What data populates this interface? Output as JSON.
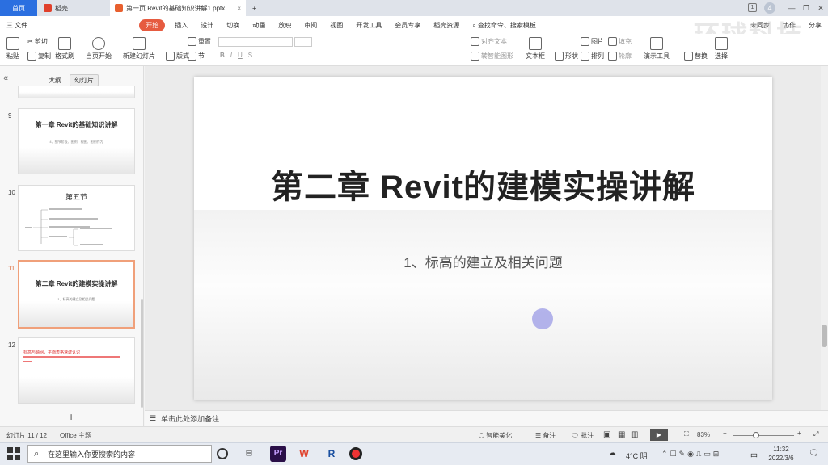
{
  "tabs": [
    {
      "label": "首页"
    },
    {
      "label": "稻壳"
    },
    {
      "label": "第一页  Revit的基础知识讲解1.pptx"
    },
    {
      "label": "+"
    }
  ],
  "window": {
    "badge": "1",
    "user": "4"
  },
  "menu": {
    "file": "三 文件",
    "items": [
      "开始",
      "插入",
      "设计",
      "切换",
      "动画",
      "放映",
      "审阅",
      "视图",
      "开发工具",
      "会员专享",
      "稻壳资源"
    ],
    "search": "查找命令、搜索模板",
    "right": [
      "未同步",
      "协作",
      "分享"
    ]
  },
  "ribbon": {
    "paste": "粘贴",
    "cut": "剪切",
    "copy": "复制",
    "format_painter": "格式刷",
    "play_from_current": "当页开始",
    "new_slide": "新建幻灯片",
    "layout": "版式",
    "section": "节",
    "reset": "重置",
    "bold": "B",
    "italic": "I",
    "underline": "U",
    "strike": "S",
    "align_text": "对齐文本",
    "convert_smartart": "转智能图形",
    "textbox": "文本框",
    "shape": "形状",
    "arrange": "排列",
    "picture": "图片",
    "fill": "填充",
    "outline": "轮廓",
    "presenter_tools": "演示工具",
    "replace": "替换",
    "select": "选择"
  },
  "panel": {
    "tab_outline": "大纲",
    "tab_slides": "幻灯片",
    "collapse": "«",
    "add": "+"
  },
  "thumbs": [
    {
      "num": "9",
      "title": "第一章  Revit的基础知识讲解",
      "sub": "4、细节阶段、图例、视图、图例作为"
    },
    {
      "num": "10",
      "title": "第五节",
      "sub": ""
    },
    {
      "num": "11",
      "title": "第二章  Revit的建模实操讲解",
      "sub": "1、标高的建立及相关问题"
    },
    {
      "num": "12",
      "title": "",
      "sub": "标高与轴网，平面表格速建认识"
    }
  ],
  "slide": {
    "title": "第二章  Revit的建模实操讲解",
    "subtitle": "1、标高的建立及相关问题"
  },
  "notes": {
    "placeholder": "单击此处添加备注"
  },
  "status": {
    "slide_count": "幻灯片 11 / 12",
    "theme": "Office 主题",
    "beautify": "智能美化",
    "remarks": "备注",
    "comment": "批注",
    "zoom": "83%",
    "zoom_value": 83
  },
  "taskbar": {
    "search_placeholder": "在这里输入你要搜索的内容",
    "weather": "4°C 阴",
    "ime": "中",
    "time": "11:32",
    "date": "2022/3/6"
  },
  "watermark": "环球科技"
}
